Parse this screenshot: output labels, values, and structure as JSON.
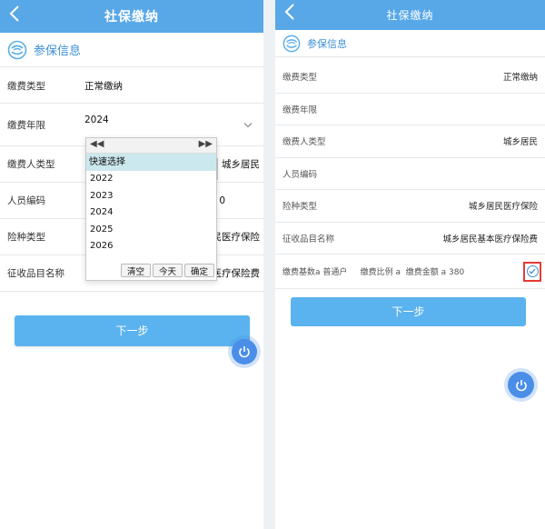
{
  "left": {
    "header": {
      "title": "社保缴纳",
      "back_icon": "chevron-left-icon"
    },
    "section_title": "参保信息",
    "rows": [
      {
        "label": "缴费类型",
        "value": "正常缴纳"
      },
      {
        "label": "缴费年限",
        "value": "2024"
      },
      {
        "label": "缴费人类型",
        "value": "城乡居民"
      },
      {
        "label": "人员编码",
        "value": "0"
      },
      {
        "label": "险种类型",
        "value": "民医疗保险"
      },
      {
        "label": "征收品目名称",
        "value": "医疗保险费"
      }
    ],
    "picker": {
      "prev_label": "◀◀",
      "next_label": "▶▶",
      "quick_label": "快速选择",
      "years": [
        "2022",
        "2023",
        "2024",
        "2025",
        "2026"
      ],
      "buttons": {
        "clear": "清空",
        "today": "今天",
        "confirm": "确定"
      }
    },
    "next_button": "下一步"
  },
  "right": {
    "header": {
      "title": "社保缴纳",
      "back_icon": "chevron-left-icon"
    },
    "section_title": "参保信息",
    "rows": [
      {
        "label": "缴费类型",
        "value": "正常缴纳"
      },
      {
        "label": "缴费年限",
        "value": ""
      },
      {
        "label": "缴费人类型",
        "value": "城乡居民"
      },
      {
        "label": "人员编码",
        "value": ""
      },
      {
        "label": "险种类型",
        "value": "城乡居民医疗保险"
      },
      {
        "label": "征收品目名称",
        "value": "城乡居民基本医疗保险费"
      }
    ],
    "base_row": "缴费基数a 普通户     缴费比例 a  缴费金额 a 380",
    "next_button": "下一步"
  },
  "colors": {
    "header": "#58a8e8",
    "button": "#5ab3ee",
    "accent": "#3d8fd6",
    "highlight": "#e53935"
  }
}
